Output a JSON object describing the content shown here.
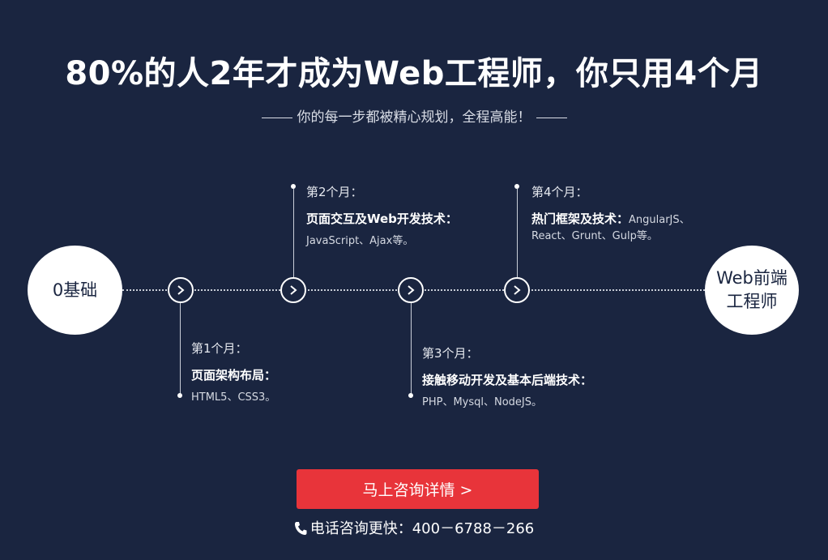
{
  "header": {
    "title": "80%的人2年才成为Web工程师，你只用4个月",
    "subtitle": "你的每一步都被精心规划，全程高能！"
  },
  "timeline": {
    "start": "0基础",
    "end_line1": "Web前端",
    "end_line2": "工程师",
    "steps": [
      {
        "label": "第1个月：",
        "heading": "页面架构布局：",
        "detail": "HTML5、CSS3。"
      },
      {
        "label": "第2个月：",
        "heading": "页面交互及Web开发技术：",
        "detail": "JavaScript、Ajax等。"
      },
      {
        "label": "第3个月：",
        "heading": "接触移动开发及基本后端技术：",
        "detail": "PHP、Mysql、NodeJS。"
      },
      {
        "label": "第4个月：",
        "heading": "热门框架及技术：",
        "detail_a": "AngularJS、",
        "detail_b": "React、Grunt、Gulp等。"
      }
    ]
  },
  "cta": {
    "label": "马上咨询详情 >"
  },
  "contact": {
    "text": "电话咨询更快：400－6788－266"
  },
  "icons": [
    "chevron-right-icon",
    "phone-icon"
  ],
  "colors": {
    "background": "#1a2540",
    "accent": "#e8343a"
  }
}
